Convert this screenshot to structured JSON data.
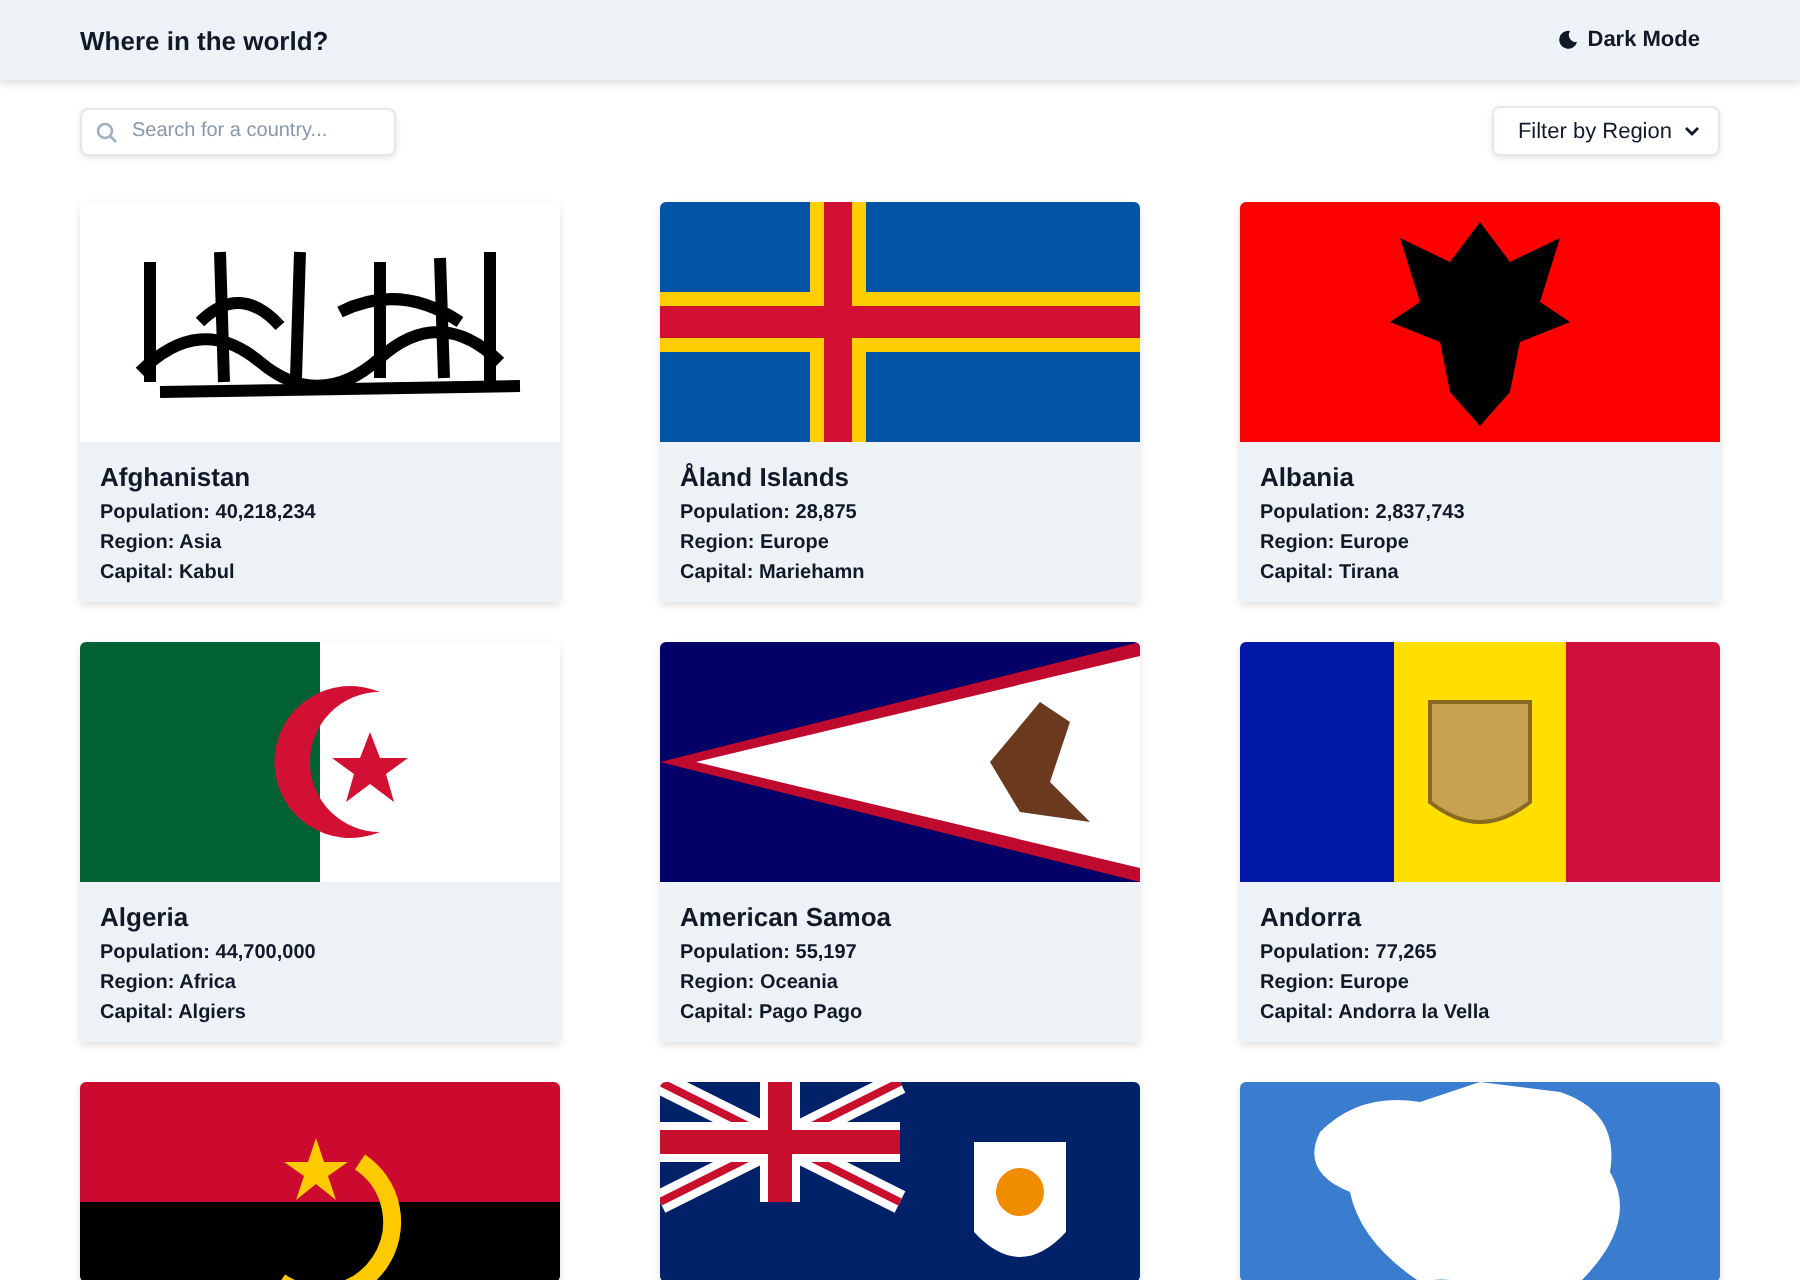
{
  "header": {
    "title": "Where in the world?",
    "theme_toggle": "Dark Mode"
  },
  "search": {
    "placeholder": "Search for a country..."
  },
  "filter": {
    "label": "Filter by Region"
  },
  "countries": [
    {
      "kind": "afghanistan",
      "name": "Afghanistan",
      "population": "Population: 40,218,234",
      "region": "Region: Asia",
      "capital": "Capital: Kabul"
    },
    {
      "kind": "aland",
      "name": "Åland Islands",
      "population": "Population: 28,875",
      "region": "Region: Europe",
      "capital": "Capital: Mariehamn"
    },
    {
      "kind": "albania",
      "name": "Albania",
      "population": "Population: 2,837,743",
      "region": "Region: Europe",
      "capital": "Capital: Tirana"
    },
    {
      "kind": "algeria",
      "name": "Algeria",
      "population": "Population: 44,700,000",
      "region": "Region: Africa",
      "capital": "Capital: Algiers"
    },
    {
      "kind": "american_samoa",
      "name": "American Samoa",
      "population": "Population: 55,197",
      "region": "Region: Oceania",
      "capital": "Capital: Pago Pago"
    },
    {
      "kind": "andorra",
      "name": "Andorra",
      "population": "Population: 77,265",
      "region": "Region: Europe",
      "capital": "Capital: Andorra la Vella"
    },
    {
      "kind": "angola"
    },
    {
      "kind": "anguilla"
    },
    {
      "kind": "antarctica"
    }
  ]
}
